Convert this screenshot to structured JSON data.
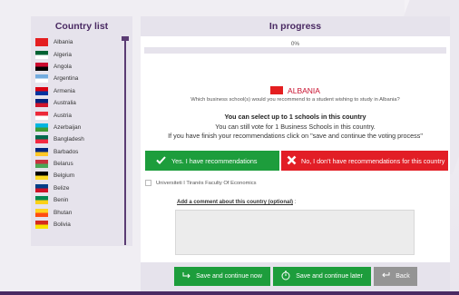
{
  "country_list": {
    "title": "Country list",
    "items": [
      {
        "label": "Albania",
        "flag": [
          "#e41e20",
          "#e41e20"
        ]
      },
      {
        "label": "Algeria",
        "flag": [
          "#006233",
          "#ffffff"
        ]
      },
      {
        "label": "Angola",
        "flag": [
          "#cc092f",
          "#000000"
        ]
      },
      {
        "label": "Argentina",
        "flag": [
          "#74acdf",
          "#ffffff"
        ]
      },
      {
        "label": "Armenia",
        "flag": [
          "#d90012",
          "#0033a0"
        ]
      },
      {
        "label": "Australia",
        "flag": [
          "#00247d",
          "#cf142b"
        ]
      },
      {
        "label": "Austria",
        "flag": [
          "#ed2939",
          "#ffffff"
        ]
      },
      {
        "label": "Azerbaijan",
        "flag": [
          "#00b5e2",
          "#3f9c35"
        ]
      },
      {
        "label": "Bangladesh",
        "flag": [
          "#006a4e",
          "#f42a41"
        ]
      },
      {
        "label": "Barbados",
        "flag": [
          "#00267f",
          "#ffc726"
        ]
      },
      {
        "label": "Belarus",
        "flag": [
          "#c8313e",
          "#4aa657"
        ]
      },
      {
        "label": "Belgium",
        "flag": [
          "#000000",
          "#fdda24"
        ]
      },
      {
        "label": "Belize",
        "flag": [
          "#003f87",
          "#ce1126"
        ]
      },
      {
        "label": "Benin",
        "flag": [
          "#008751",
          "#fcd116"
        ]
      },
      {
        "label": "Bhutan",
        "flag": [
          "#ffd520",
          "#ff4e12"
        ]
      },
      {
        "label": "Bolivia",
        "flag": [
          "#d52b1e",
          "#f9e300"
        ]
      }
    ]
  },
  "progress": {
    "title": "In progress",
    "percent_label": "0%",
    "value": 0
  },
  "country": {
    "name": "ALBANIA",
    "flag": [
      "#e41e20",
      "#e41e20"
    ]
  },
  "question": "Which business school(s) would you recommend to a student wishing to study in Albania?",
  "notes": {
    "line1": "You can select up to 1 schools in this country",
    "line2": "You can still vote for 1 Business Schools in this country.",
    "line3": "If you have finish your recommendations click on \"save and continue the voting process\""
  },
  "buttons": {
    "yes": "Yes. I have recommendations",
    "no": "No, I don't have recommendations for this country",
    "save_continue_now": "Save and continue now",
    "save_continue_later": "Save and continue later",
    "back": "Back"
  },
  "school": {
    "label": "Universiteti I Tiranës Faculty Of Economics",
    "checked": false
  },
  "comment": {
    "label": "Add a comment about this country (optional)",
    "suffix": " :",
    "value": ""
  },
  "colors": {
    "brand": "#4a2a63",
    "green": "#1d9d3c",
    "red": "#e21e26",
    "grey": "#949494"
  },
  "icons": {
    "yes": "checkmark-icon",
    "no": "cross-icon",
    "save_now": "enter-arrow-icon",
    "save_later": "stopwatch-icon",
    "back": "return-arrow-icon"
  }
}
